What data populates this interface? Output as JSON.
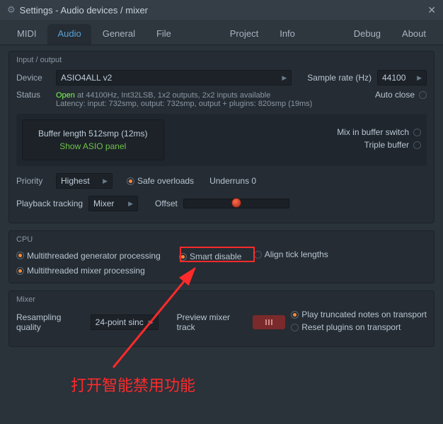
{
  "window": {
    "title": "Settings - Audio devices / mixer"
  },
  "tabs": {
    "midi": "MIDI",
    "audio": "Audio",
    "general": "General",
    "file": "File",
    "project": "Project",
    "info": "Info",
    "debug": "Debug",
    "about": "About"
  },
  "io": {
    "title": "Input / output",
    "device_label": "Device",
    "device_value": "ASIO4ALL v2",
    "status_label": "Status",
    "status_open": "Open",
    "status_line1": " at 44100Hz, Int32LSB, 1x2 outputs, 2x2 inputs available",
    "status_line2": "Latency: input: 732smp, output: 732smp, output + plugins: 820smp (19ms)",
    "sample_rate_label": "Sample rate (Hz)",
    "sample_rate_value": "44100",
    "auto_close": "Auto close",
    "buffer_line": "Buffer length 512smp (12ms)",
    "show_asio": "Show ASIO panel",
    "mix_in_buffer": "Mix in buffer switch",
    "triple_buffer": "Triple buffer",
    "priority_label": "Priority",
    "priority_value": "Highest",
    "safe_overloads": "Safe overloads",
    "underruns": "Underruns 0",
    "playback_label": "Playback tracking",
    "playback_value": "Mixer",
    "offset_label": "Offset"
  },
  "cpu": {
    "title": "CPU",
    "mt_gen": "Multithreaded generator processing",
    "mt_mix": "Multithreaded mixer processing",
    "smart_disable": "Smart disable",
    "align_ticks": "Align tick lengths"
  },
  "mixer": {
    "title": "Mixer",
    "resampling_label": "Resampling quality",
    "resampling_value": "24-point sinc",
    "preview_label": "Preview mixer track",
    "play_truncated": "Play truncated notes on transport",
    "reset_plugins": "Reset plugins on transport"
  },
  "annotation": {
    "text": "打开智能禁用功能"
  }
}
